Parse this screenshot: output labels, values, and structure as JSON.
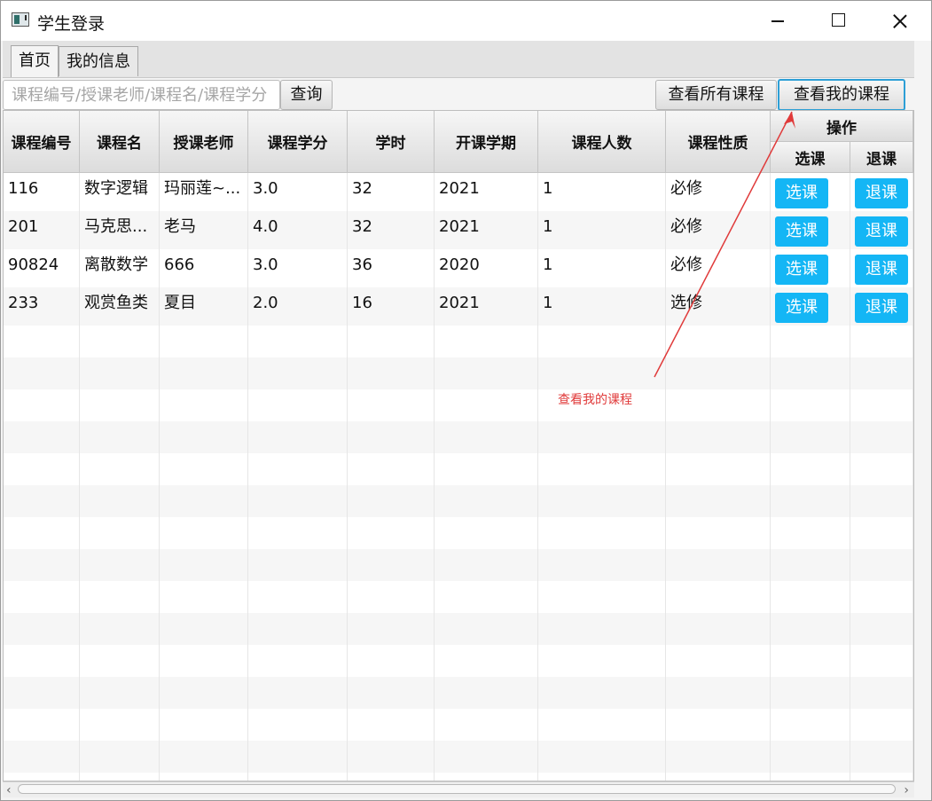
{
  "window": {
    "title": "学生登录"
  },
  "tabs": [
    {
      "label": "首页",
      "active": true
    },
    {
      "label": "我的信息",
      "active": false
    }
  ],
  "search": {
    "placeholder": "课程编号/授课老师/课程名/课程学分",
    "value": ""
  },
  "buttons": {
    "query": "查询",
    "view_all": "查看所有课程",
    "view_mine": "查看我的课程"
  },
  "table": {
    "headers": [
      "课程编号",
      "课程名",
      "授课老师",
      "课程学分",
      "学时",
      "开课学期",
      "课程人数",
      "课程性质"
    ],
    "action_header": "操作",
    "action_subheaders": [
      "选课",
      "退课"
    ],
    "rows": [
      {
        "cells": [
          "116",
          "数字逻辑",
          "玛丽莲~...",
          "3.0",
          "32",
          "2021",
          "1",
          "必修"
        ],
        "select_label": "选课",
        "drop_label": "退课"
      },
      {
        "cells": [
          "201",
          "马克思...",
          "老马",
          "4.0",
          "32",
          "2021",
          "1",
          "必修"
        ],
        "select_label": "选课",
        "drop_label": "退课"
      },
      {
        "cells": [
          "90824",
          "离散数学",
          "666",
          "3.0",
          "36",
          "2020",
          "1",
          "必修"
        ],
        "select_label": "选课",
        "drop_label": "退课"
      },
      {
        "cells": [
          "233",
          "观赏鱼类",
          "夏目",
          "2.0",
          "16",
          "2021",
          "1",
          "选修"
        ],
        "select_label": "选课",
        "drop_label": "退课"
      }
    ]
  },
  "annotation": {
    "text": "查看我的课程",
    "color": "#e03a3a"
  },
  "colors": {
    "accent": "#14b6f5",
    "focus_border": "#2d9fd6"
  }
}
